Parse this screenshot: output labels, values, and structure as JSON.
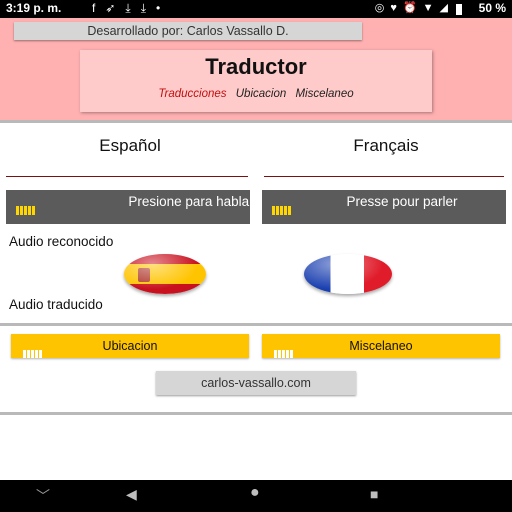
{
  "status_bar": {
    "time": "3:19 p. m.",
    "left_icons": [
      "facebook-icon",
      "send-icon",
      "download-icon",
      "download-icon",
      "dot-icon"
    ],
    "right_icons": [
      "headset-icon",
      "location-icon",
      "alarm-icon",
      "wifi-icon",
      "signal-icon"
    ],
    "battery": "50 %"
  },
  "header": {
    "developer_label": "Desarrollado por: Carlos Vassallo D.",
    "title": "Traductor",
    "tabs": [
      {
        "label": "Traducciones",
        "active": true
      },
      {
        "label": "Ubicacion",
        "active": false
      },
      {
        "label": "Miscelaneo",
        "active": false
      }
    ]
  },
  "languages": {
    "left": {
      "name": "Español",
      "speak_button": "Presione para hablar",
      "flag": "spain-flag-icon"
    },
    "right": {
      "name": "Français",
      "speak_button": "Presse pour parler",
      "flag": "france-flag-icon"
    }
  },
  "labels": {
    "recognized": "Audio reconocido",
    "translated": "Audio traducido"
  },
  "nav_buttons": {
    "location": "Ubicacion",
    "misc": "Miscelaneo"
  },
  "website_button": "carlos-vassallo.com",
  "colors": {
    "header_bg": "#ffb1b1",
    "active_tab": "#c01010",
    "speak_button": "#5b5b5b",
    "accent_yellow": "#ffc400"
  }
}
